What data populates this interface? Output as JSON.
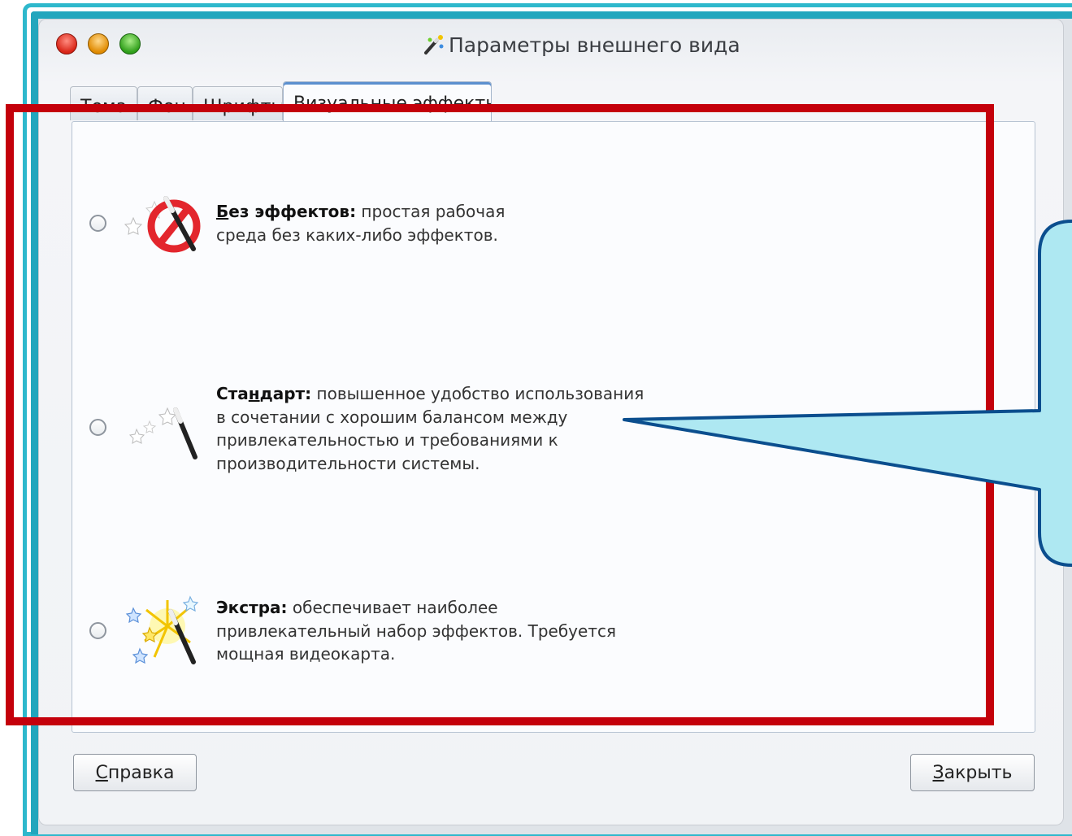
{
  "window": {
    "title": "Параметры внешнего вида"
  },
  "tabs": [
    {
      "label": "Тема"
    },
    {
      "label": "Фон"
    },
    {
      "label": "Шрифты"
    },
    {
      "label": "Визуальные эффекты",
      "active": true
    }
  ],
  "options": [
    {
      "bold_prefix": "Б",
      "bold_rest": "ез эффектов:",
      "line1_rest": " простая рабочая",
      "line2": "среда без каких-либо эффектов.",
      "icon": "no-effects-icon",
      "selected": false
    },
    {
      "bold_a": "Ста",
      "bold_u": "н",
      "bold_b": "дарт:",
      "line1_rest": " повышенное удобство использования",
      "line2": "в сочетании с хорошим балансом между",
      "line3": "привлекательностью и требованиями к",
      "line4": "производительности системы.",
      "icon": "standard-effects-wand-icon",
      "selected": false
    },
    {
      "bold": "Экстра:",
      "line1_rest": " обеспечивает наиболее",
      "line2": "привлекательный набор эффектов. Требуется",
      "line3": "мощная видеокарта.",
      "icon": "extra-effects-sparkle-wand-icon",
      "selected": false
    }
  ],
  "buttons": {
    "help_u": "С",
    "help_rest": "правка",
    "close_u": "З",
    "close_rest": "акрыть"
  },
  "colors": {
    "annotation_frame": "#c4000b",
    "callout_fill": "#aee8f2",
    "callout_stroke": "#0b4e8e",
    "slide_border": "#22a6bd"
  }
}
